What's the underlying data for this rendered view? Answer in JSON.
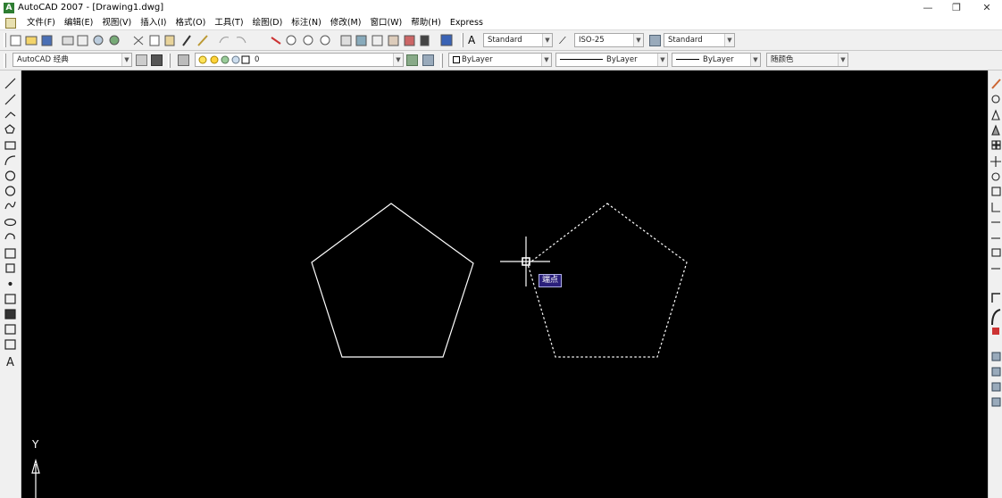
{
  "window": {
    "title": "AutoCAD 2007 - [Drawing1.dwg]",
    "controls": {
      "minimize": "—",
      "restore": "❐",
      "close": "✕"
    }
  },
  "menu": {
    "items": [
      "文件(F)",
      "编辑(E)",
      "视图(V)",
      "插入(I)",
      "格式(O)",
      "工具(T)",
      "绘图(D)",
      "标注(N)",
      "修改(M)",
      "窗口(W)",
      "帮助(H)",
      "Express"
    ]
  },
  "toolbar": {
    "text_style": "Standard",
    "dim_style": "ISO-25",
    "table_style": "Standard"
  },
  "properties": {
    "workspace": "AutoCAD 经典",
    "layer": "0",
    "color": "ByLayer",
    "linetype": "ByLayer",
    "lineweight": "ByLayer",
    "plotstyle": "随颜色"
  },
  "canvas": {
    "tooltip": "端点",
    "ucs_y_label": "Y"
  },
  "colors": {
    "canvas_bg": "#000000",
    "drawing_line": "#ffffff",
    "tooltip_bg": "#2a1f7a"
  }
}
